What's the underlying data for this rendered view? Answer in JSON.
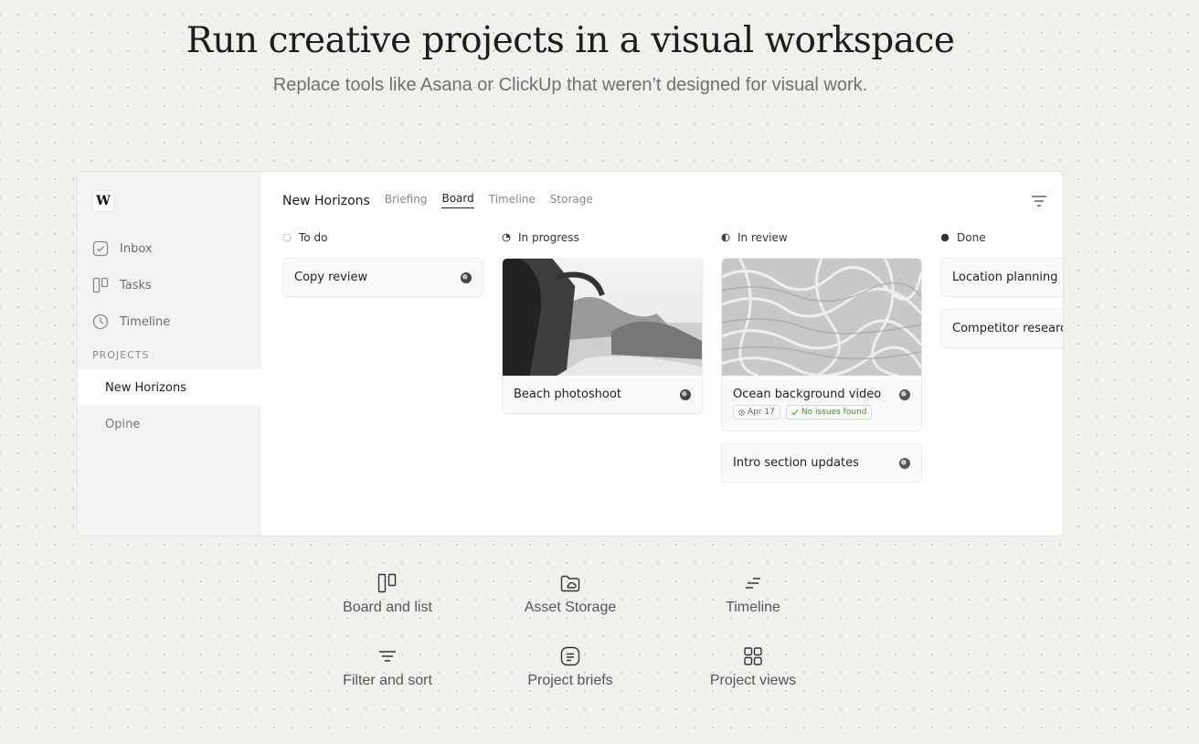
{
  "hero": {
    "title": "Run creative projects in a visual workspace",
    "subtitle": "Replace tools like Asana or ClickUp that weren’t designed for visual work."
  },
  "app": {
    "logo": "W",
    "sidebar": {
      "items": [
        {
          "label": "Inbox",
          "icon": "inbox-icon"
        },
        {
          "label": "Tasks",
          "icon": "tasks-icon"
        },
        {
          "label": "Timeline",
          "icon": "clock-icon"
        }
      ],
      "section_label": "PROJECTS",
      "projects": [
        {
          "label": "New Horizons",
          "active": true
        },
        {
          "label": "Opine",
          "active": false
        }
      ]
    },
    "header": {
      "project_name": "New Horizons",
      "tabs": [
        {
          "label": "Briefing",
          "active": false
        },
        {
          "label": "Board",
          "active": true
        },
        {
          "label": "Timeline",
          "active": false
        },
        {
          "label": "Storage",
          "active": false
        }
      ],
      "filter_icon": "filter-icon"
    },
    "columns": [
      {
        "title": "To do",
        "status_icon": "status-todo-icon",
        "cards": [
          {
            "title": "Copy review"
          }
        ]
      },
      {
        "title": "In progress",
        "status_icon": "status-in-progress-icon",
        "cards": [
          {
            "title": "Beach photoshoot",
            "image": "palm-coast-photo"
          }
        ]
      },
      {
        "title": "In review",
        "status_icon": "status-in-review-icon",
        "cards": [
          {
            "title": "Ocean background video",
            "image": "water-ripples-photo",
            "date": "Apr 17",
            "badge": "No issues found"
          },
          {
            "title": "Intro section updates"
          }
        ]
      },
      {
        "title": "Done",
        "status_icon": "status-done-icon",
        "cards": [
          {
            "title": "Location planning"
          },
          {
            "title": "Competitor research"
          }
        ]
      }
    ]
  },
  "features": [
    {
      "label": "Board and list",
      "icon": "board-icon"
    },
    {
      "label": "Asset Storage",
      "icon": "folder-cloud-icon"
    },
    {
      "label": "Timeline",
      "icon": "timeline-icon"
    },
    {
      "label": "Filter and sort",
      "icon": "filter-icon"
    },
    {
      "label": "Project briefs",
      "icon": "brief-icon"
    },
    {
      "label": "Project views",
      "icon": "grid-icon"
    }
  ]
}
